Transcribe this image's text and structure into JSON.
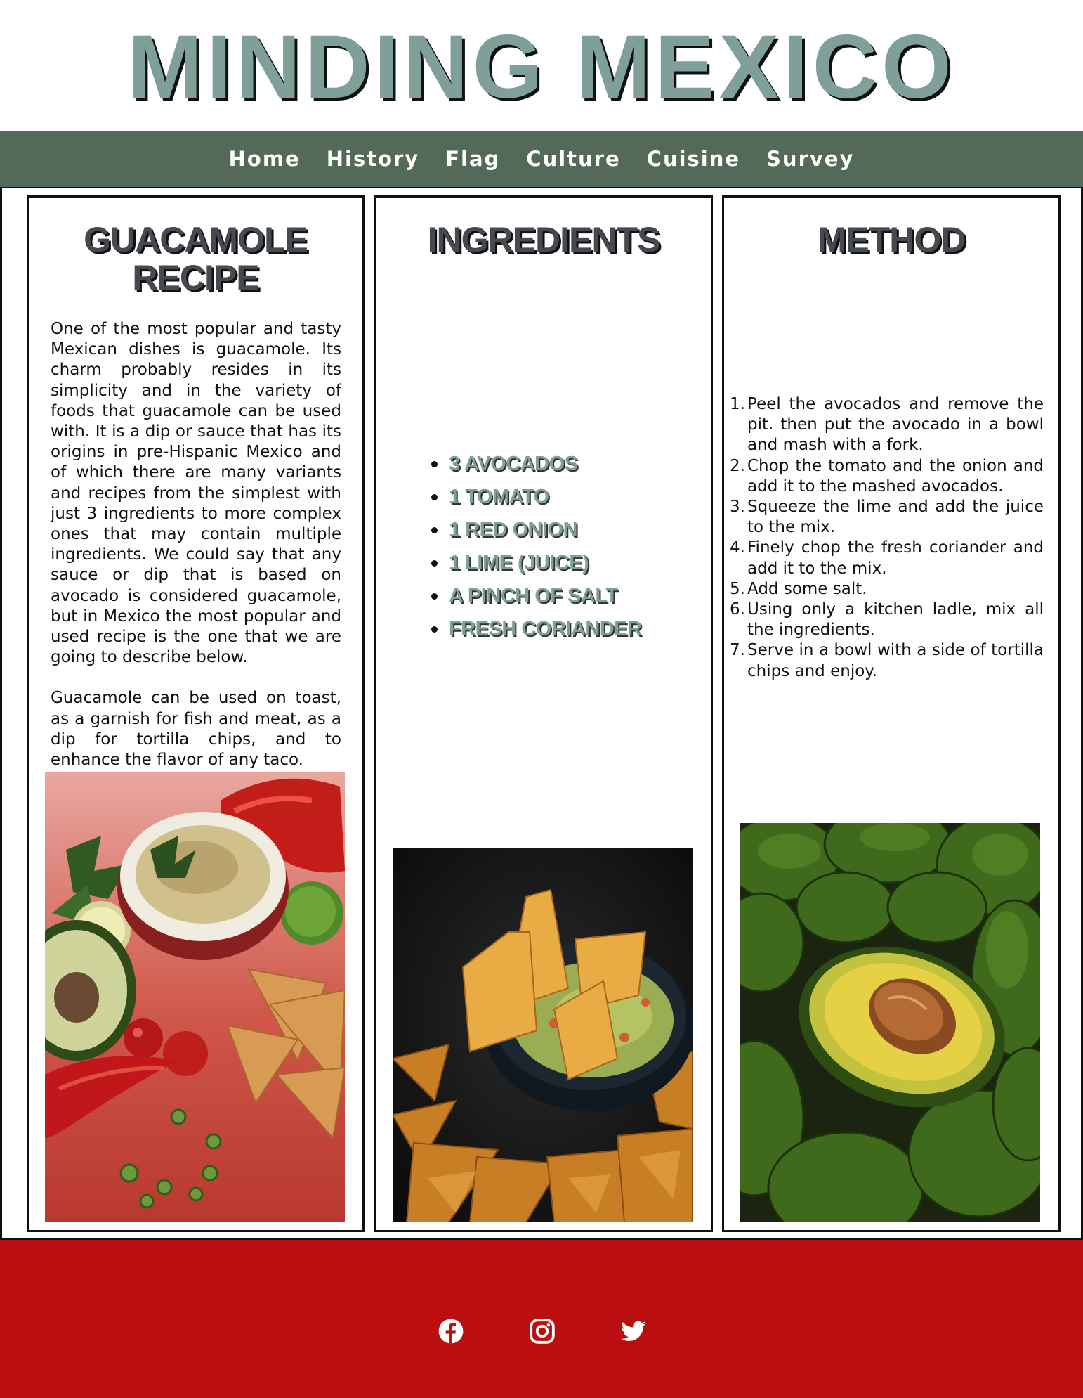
{
  "site": {
    "title": "MINDING MEXICO"
  },
  "nav": {
    "items": [
      {
        "label": "Home"
      },
      {
        "label": "History"
      },
      {
        "label": "Flag"
      },
      {
        "label": "Culture"
      },
      {
        "label": "Cuisine"
      },
      {
        "label": "Survey"
      }
    ]
  },
  "recipe": {
    "title_line1": "GUACAMOLE",
    "title_line2": "RECIPE",
    "paragraph1": "One of the most popular and tasty Mexican dishes is guacamole. Its charm probably resides in its simplicity and in the variety of foods that guacamole can be used with. It is a dip or sauce that has its origins in pre-Hispanic Mexico and of which there are many variants and recipes from the simplest with just 3 ingredients to more complex ones that may contain multiple ingredients. We could say that any sauce or dip that is based on avocado is considered guacamole, but in Mexico the most popular and used recipe is the one that we are going to describe below.",
    "paragraph2": "Guacamole can be used on toast, as a garnish for fish and meat, as a dip for tortilla chips, and to enhance the flavor of any taco.",
    "image": "guacamole-bowl-red-background"
  },
  "ingredients": {
    "title": "INGREDIENTS",
    "items": [
      "3 AVOCADOS",
      "1 TOMATO",
      "1 RED ONION",
      "1 LIME (JUICE)",
      "A PINCH OF SALT",
      "FRESH CORIANDER"
    ],
    "image": "guacamole-with-tortilla-chips"
  },
  "method": {
    "title": "METHOD",
    "steps": [
      {
        "num": "1.",
        "text": "Peel the avocados and remove the pit. then put the avocado in a bowl and mash with a fork."
      },
      {
        "num": "2.",
        "text": "Chop the tomato and the onion and add it to the mashed avocados."
      },
      {
        "num": "3.",
        "text": "Squeeze the lime and add the juice to the mix."
      },
      {
        "num": "4.",
        "text": "Finely chop the fresh coriander and add it to the mix."
      },
      {
        "num": "5.",
        "text": "Add some salt."
      },
      {
        "num": "6.",
        "text": "Using only a kitchen ladle, mix all the ingredients."
      },
      {
        "num": "7.",
        "text": "Serve in a bowl with a side of tortilla chips and enjoy."
      }
    ],
    "image": "halved-avocado-pile"
  },
  "footer": {
    "icons": [
      "facebook-icon",
      "instagram-icon",
      "twitter-icon"
    ]
  },
  "colors": {
    "title": "#7f9f9a",
    "nav_bg": "#546a58",
    "footer_bg": "#bb0e10",
    "heading": "#444a50"
  }
}
